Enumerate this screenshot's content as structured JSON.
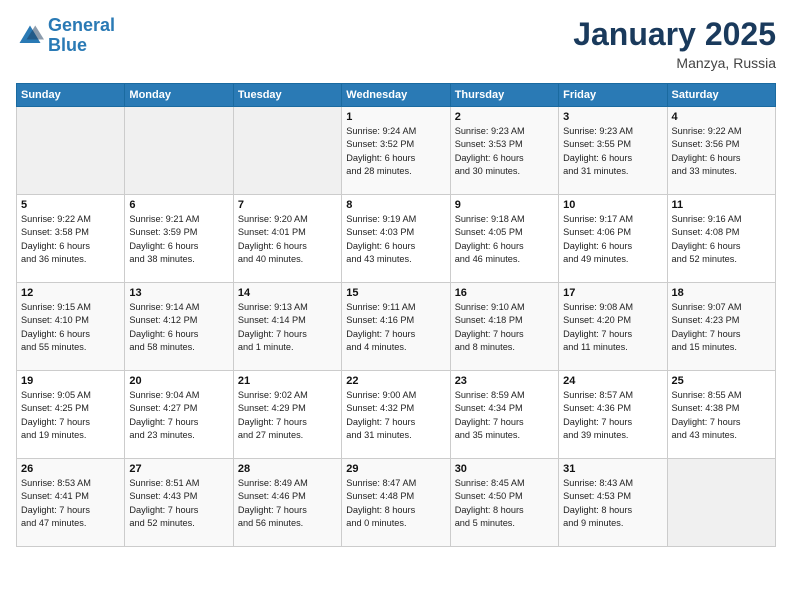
{
  "logo": {
    "line1": "General",
    "line2": "Blue"
  },
  "title": "January 2025",
  "location": "Manzya, Russia",
  "days_of_week": [
    "Sunday",
    "Monday",
    "Tuesday",
    "Wednesday",
    "Thursday",
    "Friday",
    "Saturday"
  ],
  "weeks": [
    [
      {
        "num": "",
        "info": ""
      },
      {
        "num": "",
        "info": ""
      },
      {
        "num": "",
        "info": ""
      },
      {
        "num": "1",
        "info": "Sunrise: 9:24 AM\nSunset: 3:52 PM\nDaylight: 6 hours\nand 28 minutes."
      },
      {
        "num": "2",
        "info": "Sunrise: 9:23 AM\nSunset: 3:53 PM\nDaylight: 6 hours\nand 30 minutes."
      },
      {
        "num": "3",
        "info": "Sunrise: 9:23 AM\nSunset: 3:55 PM\nDaylight: 6 hours\nand 31 minutes."
      },
      {
        "num": "4",
        "info": "Sunrise: 9:22 AM\nSunset: 3:56 PM\nDaylight: 6 hours\nand 33 minutes."
      }
    ],
    [
      {
        "num": "5",
        "info": "Sunrise: 9:22 AM\nSunset: 3:58 PM\nDaylight: 6 hours\nand 36 minutes."
      },
      {
        "num": "6",
        "info": "Sunrise: 9:21 AM\nSunset: 3:59 PM\nDaylight: 6 hours\nand 38 minutes."
      },
      {
        "num": "7",
        "info": "Sunrise: 9:20 AM\nSunset: 4:01 PM\nDaylight: 6 hours\nand 40 minutes."
      },
      {
        "num": "8",
        "info": "Sunrise: 9:19 AM\nSunset: 4:03 PM\nDaylight: 6 hours\nand 43 minutes."
      },
      {
        "num": "9",
        "info": "Sunrise: 9:18 AM\nSunset: 4:05 PM\nDaylight: 6 hours\nand 46 minutes."
      },
      {
        "num": "10",
        "info": "Sunrise: 9:17 AM\nSunset: 4:06 PM\nDaylight: 6 hours\nand 49 minutes."
      },
      {
        "num": "11",
        "info": "Sunrise: 9:16 AM\nSunset: 4:08 PM\nDaylight: 6 hours\nand 52 minutes."
      }
    ],
    [
      {
        "num": "12",
        "info": "Sunrise: 9:15 AM\nSunset: 4:10 PM\nDaylight: 6 hours\nand 55 minutes."
      },
      {
        "num": "13",
        "info": "Sunrise: 9:14 AM\nSunset: 4:12 PM\nDaylight: 6 hours\nand 58 minutes."
      },
      {
        "num": "14",
        "info": "Sunrise: 9:13 AM\nSunset: 4:14 PM\nDaylight: 7 hours\nand 1 minute."
      },
      {
        "num": "15",
        "info": "Sunrise: 9:11 AM\nSunset: 4:16 PM\nDaylight: 7 hours\nand 4 minutes."
      },
      {
        "num": "16",
        "info": "Sunrise: 9:10 AM\nSunset: 4:18 PM\nDaylight: 7 hours\nand 8 minutes."
      },
      {
        "num": "17",
        "info": "Sunrise: 9:08 AM\nSunset: 4:20 PM\nDaylight: 7 hours\nand 11 minutes."
      },
      {
        "num": "18",
        "info": "Sunrise: 9:07 AM\nSunset: 4:23 PM\nDaylight: 7 hours\nand 15 minutes."
      }
    ],
    [
      {
        "num": "19",
        "info": "Sunrise: 9:05 AM\nSunset: 4:25 PM\nDaylight: 7 hours\nand 19 minutes."
      },
      {
        "num": "20",
        "info": "Sunrise: 9:04 AM\nSunset: 4:27 PM\nDaylight: 7 hours\nand 23 minutes."
      },
      {
        "num": "21",
        "info": "Sunrise: 9:02 AM\nSunset: 4:29 PM\nDaylight: 7 hours\nand 27 minutes."
      },
      {
        "num": "22",
        "info": "Sunrise: 9:00 AM\nSunset: 4:32 PM\nDaylight: 7 hours\nand 31 minutes."
      },
      {
        "num": "23",
        "info": "Sunrise: 8:59 AM\nSunset: 4:34 PM\nDaylight: 7 hours\nand 35 minutes."
      },
      {
        "num": "24",
        "info": "Sunrise: 8:57 AM\nSunset: 4:36 PM\nDaylight: 7 hours\nand 39 minutes."
      },
      {
        "num": "25",
        "info": "Sunrise: 8:55 AM\nSunset: 4:38 PM\nDaylight: 7 hours\nand 43 minutes."
      }
    ],
    [
      {
        "num": "26",
        "info": "Sunrise: 8:53 AM\nSunset: 4:41 PM\nDaylight: 7 hours\nand 47 minutes."
      },
      {
        "num": "27",
        "info": "Sunrise: 8:51 AM\nSunset: 4:43 PM\nDaylight: 7 hours\nand 52 minutes."
      },
      {
        "num": "28",
        "info": "Sunrise: 8:49 AM\nSunset: 4:46 PM\nDaylight: 7 hours\nand 56 minutes."
      },
      {
        "num": "29",
        "info": "Sunrise: 8:47 AM\nSunset: 4:48 PM\nDaylight: 8 hours\nand 0 minutes."
      },
      {
        "num": "30",
        "info": "Sunrise: 8:45 AM\nSunset: 4:50 PM\nDaylight: 8 hours\nand 5 minutes."
      },
      {
        "num": "31",
        "info": "Sunrise: 8:43 AM\nSunset: 4:53 PM\nDaylight: 8 hours\nand 9 minutes."
      },
      {
        "num": "",
        "info": ""
      }
    ]
  ]
}
